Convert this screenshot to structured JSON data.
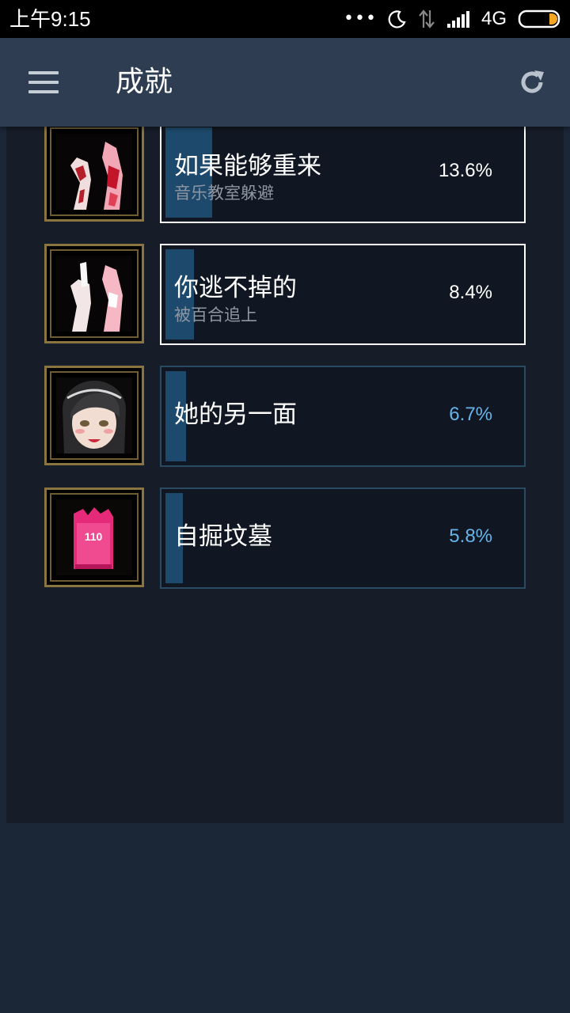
{
  "status_bar": {
    "time": "上午9:15",
    "dots": "•••",
    "network": "4G"
  },
  "header": {
    "title": "成就",
    "menu_icon": "hamburger-menu-icon",
    "refresh_icon": "refresh-icon"
  },
  "achievements": [
    {
      "name": "如果能够重来",
      "description": "音乐教室躲避",
      "percent": "13.6%",
      "fill": 0.136,
      "unlocked": true
    },
    {
      "name": "你逃不掉的",
      "description": "被百合追上",
      "percent": "8.4%",
      "fill": 0.084,
      "unlocked": true
    },
    {
      "name": "她的另一面",
      "description": "",
      "percent": "6.7%",
      "fill": 0.067,
      "unlocked": false
    },
    {
      "name": "自掘坟墓",
      "description": "",
      "percent": "5.8%",
      "fill": 0.058,
      "unlocked": false
    }
  ],
  "phone_icon_text": "110",
  "colors": {
    "status_bar_bg": "#000000",
    "app_bar_bg": "#2e3d52",
    "content_bg": "#161d28",
    "page_bg": "#1b2637",
    "progress_fill": "#1d4a6c",
    "locked_percent": "#66b4ea",
    "locked_border": "#2a4a62",
    "unlocked_border": "#ffffff"
  }
}
